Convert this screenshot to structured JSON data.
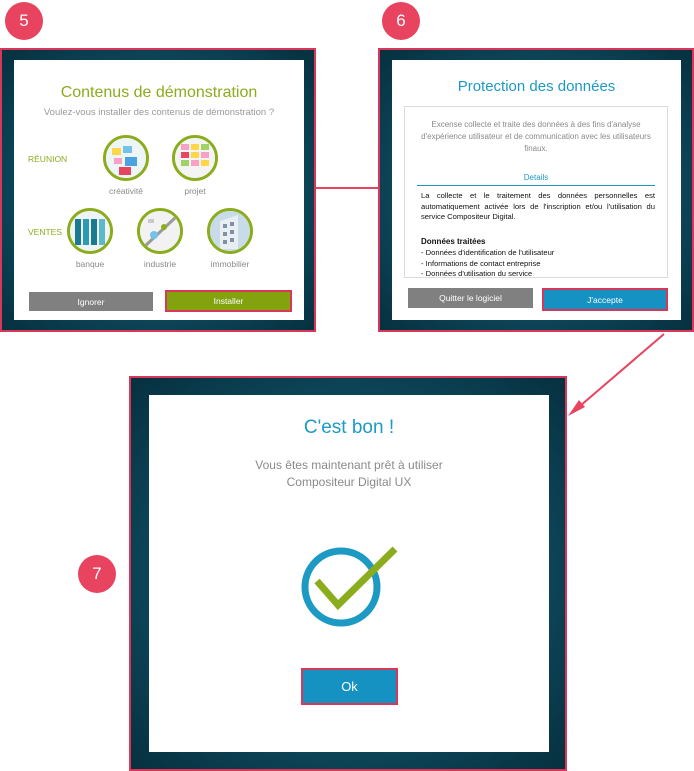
{
  "steps": {
    "five": "5",
    "six": "6",
    "seven": "7"
  },
  "demo_dialog": {
    "title": "Contenus de démonstration",
    "subtitle": "Voulez-vous installer des contenus de démonstration ?",
    "categories": [
      {
        "label": "RÉUNION",
        "items": [
          "créativité",
          "projet"
        ]
      },
      {
        "label": "VENTES",
        "items": [
          "banque",
          "industrie",
          "immobilier"
        ]
      }
    ],
    "ignore_label": "Ignorer",
    "install_label": "Installer"
  },
  "privacy_dialog": {
    "title": "Protection des données",
    "intro": "Excense collecte et traite des données à des fins d'analyse d'expérience utilisateur et de communication avec les utilisateurs finaux.",
    "details_label": "Details",
    "body": "La collecte et le traitement des données personnelles est automatiquement activée lors de l'inscription et/ou l'utilisation du service Compositeur Digital.",
    "data_heading": "Données traitées",
    "data_items": [
      "- Données d'identification de l'utilisateur",
      "- Informations de contact entreprise",
      "- Données d'utilisation du service"
    ],
    "quit_label": "Quitter le logiciel",
    "accept_label": "J'accepte"
  },
  "success_dialog": {
    "title": "C'est bon !",
    "message": "Vous êtes maintenant prêt à utiliser Compositeur Digital UX",
    "ok_label": "Ok"
  },
  "colors": {
    "accent_green": "#8bac1c",
    "accent_blue": "#1d9ac4",
    "highlight_red": "#d9365a",
    "badge_red": "#e8435f"
  },
  "icons": [
    "check-circle-icon",
    "arrow-right-icon",
    "arrow-down-left-icon"
  ]
}
